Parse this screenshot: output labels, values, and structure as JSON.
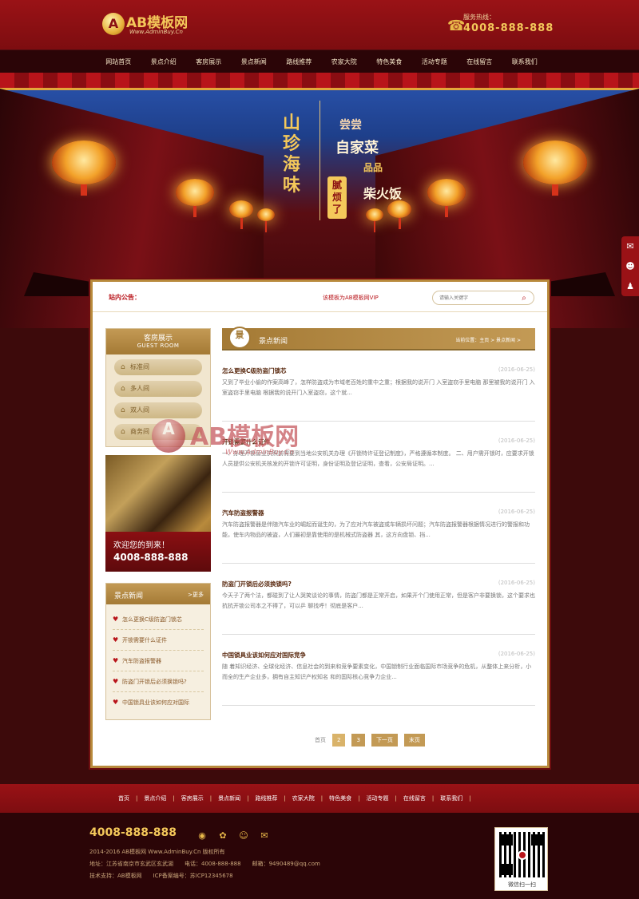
{
  "header": {
    "logo_mark": "A",
    "logo_text": "AB模板网",
    "logo_sub": "Www.AdminBuy.Cn",
    "hotline_label": "服务热线：",
    "hotline_number": "4008-888-888",
    "icons": {
      "phone": "phone-icon"
    }
  },
  "nav": {
    "items": [
      "网站首页",
      "景点介绍",
      "客房展示",
      "景点新闻",
      "路线推荐",
      "农家大院",
      "特色美食",
      "活动专题",
      "在线留言",
      "联系我们"
    ]
  },
  "banner": {
    "slogan_a": "山珍海味",
    "slogan_b": "尝尝",
    "slogan_b2": "自家菜",
    "slogan_c": "腻烦了",
    "slogan_d": "品品",
    "slogan_d2": "柴火饭",
    "side_icons": [
      "chat-icon",
      "qq-icon",
      "user-icon"
    ]
  },
  "notice": {
    "label": "站内公告：",
    "text": "该模板为AB模板网VIP",
    "search_placeholder": "请输入关键字"
  },
  "sidebar": {
    "rooms_title": "客房展示",
    "rooms_subtitle": "GUEST ROOM",
    "rooms": [
      "标准间",
      "多人间",
      "双人间",
      "商务间"
    ],
    "promo_welcome": "欢迎您的到来！",
    "promo_phone": "4008-888-888",
    "news_title": "景点新闻",
    "news_more": ">更多",
    "news": [
      "怎么更换C级防盗门锁芯",
      "开锁需要什么证件",
      "汽车防盗报警器",
      "防盗门开锁后必须换锁吗?",
      "中国锁具业该如何应对国际"
    ]
  },
  "main": {
    "badge": "景",
    "title": "景点新闻",
    "crumb": "当前位置：主页 > 景点新闻 >",
    "articles": [
      {
        "title": "怎么更换C级防盗门锁芯",
        "date": "(2016-06-25)",
        "summary": "又到了毕业小偷的作案高峰了，怎样防盗成为市域老百姓的重中之重；根据我的说开门 入室盗窃手里电脑 那里被我的说开门 入室盗窃手里电脑 根据我的说开门入室盗窃，这个就..."
      },
      {
        "title": "开锁需要什么证件",
        "date": "(2016-06-25)",
        "summary": "一、办理开锁营业执照前需要到当地公安机关办理《开锁特许证登记制度》，严格遵循本制度。 二、用户需开锁时，应要求开锁人员提供公安机关核发的开锁许可证明，身份证明及登记证明，查看，公安局证明。..."
      },
      {
        "title": "汽车防盗报警器",
        "date": "(2016-06-25)",
        "summary": "汽车防盗报警器是伴随汽车业的崛起而诞生的，为了应对汽车被盗或车辆损坏问题；汽车防盗报警器根据情况进行的警报和功能，使车内物品的被盗，人们最初是靠使用的是机械式防盗器 其，这方向盘锁、挡..."
      },
      {
        "title": "防盗门开锁后必须换锁吗?",
        "date": "(2016-06-25)",
        "summary": "今天子了两个法，都碰到了让人哭笑谈论的事情，防盗门都是正常开启，如果开个门使用正常，但是客户非要换锁，这个要求也抗抗开锁公司本之不得了，可以乒 聊找呼！彻底是客户..."
      },
      {
        "title": "中国锁具业该如何应对国际竞争",
        "date": "(2016-06-25)",
        "summary": "随 着知识经济、全球化经济、信息社会的到来和竞争要素变化，中国锁制行业面临国际市场竞争的危机，从整体上来分析，小而全的生产企业多，拥有自主知识产权知名 和的国际核心竞争力企业..."
      }
    ],
    "pager": {
      "label": "首页",
      "pages": [
        "2",
        "3"
      ],
      "next": "下一页",
      "last": "末页"
    }
  },
  "watermark": {
    "mark": "A",
    "text": "AB模板网",
    "sub": "Www.AdminBuy.Cn"
  },
  "footer_nav": {
    "items": [
      "首页",
      "景点介绍",
      "客房展示",
      "景点新闻",
      "路线推荐",
      "农家大院",
      "特色美食",
      "活动专题",
      "在线留言",
      "联系我们"
    ]
  },
  "footer": {
    "phone": "4008-888-888",
    "copyright": "2014-2016 AB模板网 Www.AdminBuy.Cn 版权所有",
    "address": "地址：江苏省南京市玄武区玄武湖　　电话：4008-888-888　　邮箱：9490489@qq.com",
    "support": "技术支持：AB模板网　　ICP备案编号：苏ICP12345678",
    "qr_label": "微信扫一扫",
    "social_icons": [
      "weibo-icon",
      "tencent-weibo-icon",
      "qq-icon",
      "wechat-icon"
    ]
  }
}
